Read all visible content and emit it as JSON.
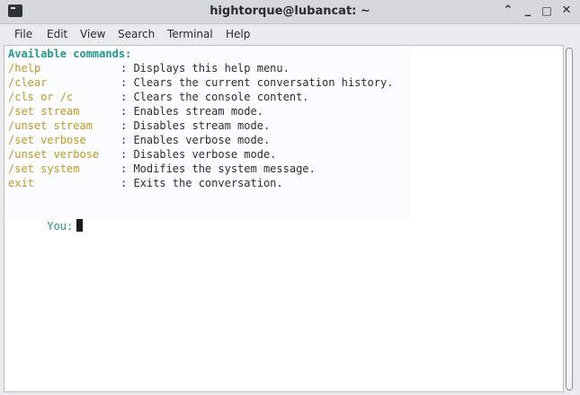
{
  "window": {
    "title": "hightorque@lubancat: ~"
  },
  "titlebar_buttons": {
    "minimize_icon": "minimize-icon",
    "maximize_icon": "maximize-icon",
    "close_icon": "close-icon",
    "shade_icon": "chevron-up-icon"
  },
  "menu": {
    "items": [
      "File",
      "Edit",
      "View",
      "Search",
      "Terminal",
      "Help"
    ]
  },
  "terminal": {
    "heading": "Available commands:",
    "commands": [
      {
        "cmd": "/help",
        "desc": ": Displays this help menu."
      },
      {
        "cmd": "/clear",
        "desc": ": Clears the current conversation history."
      },
      {
        "cmd": "/cls or /c",
        "desc": ": Clears the console content."
      },
      {
        "cmd": "/set stream",
        "desc": ": Enables stream mode."
      },
      {
        "cmd": "/unset stream",
        "desc": ": Disables stream mode."
      },
      {
        "cmd": "/set verbose",
        "desc": ": Enables verbose mode."
      },
      {
        "cmd": "/unset verbose",
        "desc": ": Disables verbose mode."
      },
      {
        "cmd": "/set system",
        "desc": ": Modifies the system message."
      },
      {
        "cmd": "exit",
        "desc": ": Exits the conversation."
      }
    ],
    "prompt": "You:"
  },
  "colors": {
    "heading": "#1f9a8c",
    "command": "#c49a1e",
    "text": "#2e2e2e",
    "background": "#ffffff"
  }
}
